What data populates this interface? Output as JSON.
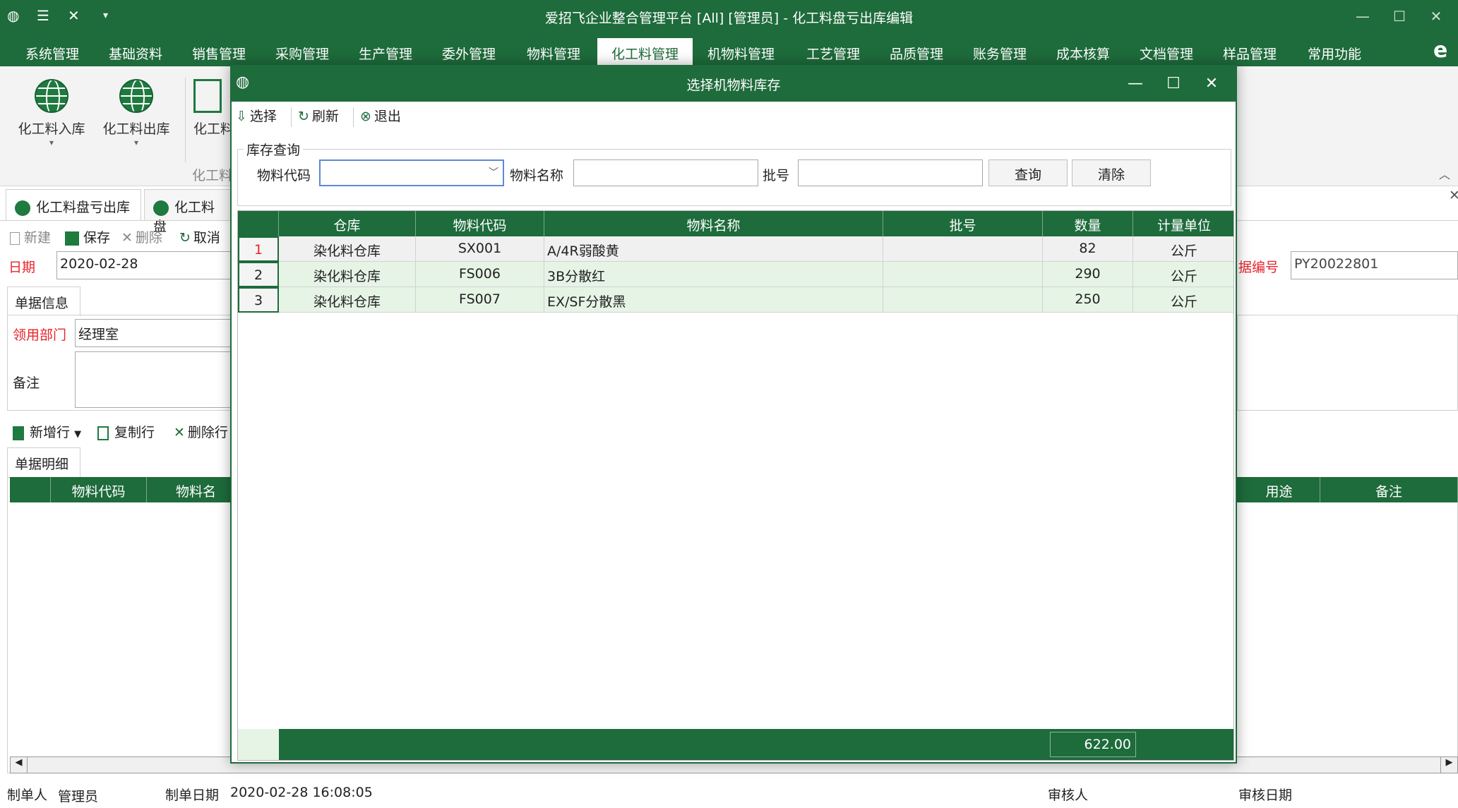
{
  "window": {
    "title": "爱招飞企业整合管理平台 [All] [管理员] - 化工料盘亏出库编辑"
  },
  "menu": [
    "系统管理",
    "基础资料",
    "销售管理",
    "采购管理",
    "生产管理",
    "委外管理",
    "物料管理",
    "化工料管理",
    "机物料管理",
    "工艺管理",
    "品质管理",
    "账务管理",
    "成本核算",
    "文档管理",
    "样品管理",
    "常用功能"
  ],
  "ribbon": {
    "btn1": "化工料入库",
    "btn2": "化工料出库",
    "btn3": "化工料",
    "group": "化工料"
  },
  "doctabs": {
    "tab1": "化工料盘亏出库",
    "tab2": "化工料盘"
  },
  "toolbar": {
    "new": "新建",
    "save": "保存",
    "delete": "删除",
    "cancel": "取消"
  },
  "form": {
    "date_label": "日期",
    "date_value": "2020-02-28",
    "docno_label": "据编号",
    "docno_value": "PY20022801",
    "info_tab": "单据信息",
    "dept_label": "领用部门",
    "dept_value": "经理室",
    "remark_label": "备注"
  },
  "detail": {
    "add_row": "新增行",
    "copy_row": "复制行",
    "delete_row": "删除行",
    "tab": "单据明细",
    "col_code": "物料代码",
    "col_name": "物料名",
    "col_use": "用途",
    "col_remark": "备注"
  },
  "status": {
    "maker_label": "制单人",
    "maker_value": "管理员",
    "date_label": "制单日期",
    "date_value": "2020-02-28 16:08:05",
    "auditor_label": "审核人",
    "audit_date_label": "审核日期"
  },
  "modal": {
    "title": "选择机物料库存",
    "select": "选择",
    "refresh": "刷新",
    "exit": "退出",
    "query_legend": "库存查询",
    "code_label": "物料代码",
    "name_label": "物料名称",
    "batch_label": "批号",
    "query_btn": "查询",
    "clear_btn": "清除",
    "columns": [
      "仓库",
      "物料代码",
      "物料名称",
      "批号",
      "数量",
      "计量单位"
    ],
    "rows": [
      {
        "no": "1",
        "warehouse": "染化料仓库",
        "code": "SX001",
        "name": "A/4R弱酸黄",
        "batch": "",
        "qty": "82",
        "unit": "公斤"
      },
      {
        "no": "2",
        "warehouse": "染化料仓库",
        "code": "FS006",
        "name": "3B分散红",
        "batch": "",
        "qty": "290",
        "unit": "公斤"
      },
      {
        "no": "3",
        "warehouse": "染化料仓库",
        "code": "FS007",
        "name": "EX/SF分散黑",
        "batch": "",
        "qty": "250",
        "unit": "公斤"
      }
    ],
    "total": "622.00"
  },
  "colors": {
    "brand": "#1e6b3b",
    "required": "#e8232a",
    "row_alt": "#e6f4e6"
  }
}
